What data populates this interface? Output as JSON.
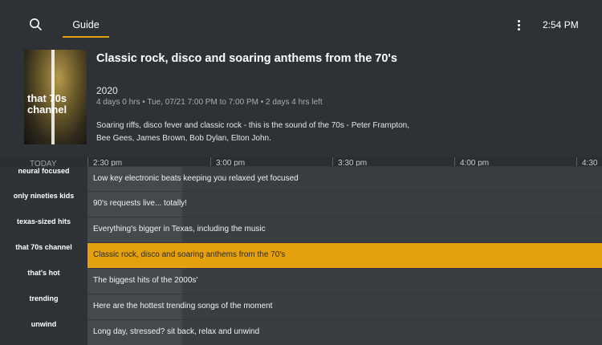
{
  "header": {
    "search_icon": "search-icon",
    "tab_guide": "Guide",
    "menu_icon": "more-vertical-icon",
    "clock": "2:54 PM",
    "accent": "#e5a00d"
  },
  "detail": {
    "poster_text": "that 70s channel",
    "title": "Classic rock, disco and soaring anthems from the 70's",
    "year": "2020",
    "meta": "4 days 0 hrs • Tue, 07/21 7:00 PM to 7:00 PM • 2 days 4 hrs left",
    "description": "Soaring riffs, disco fever and classic rock - this is the sound of the 70s - Peter Frampton, Bee Gees, James Brown, Bob Dylan, Elton John."
  },
  "timeline": {
    "today": "TODAY",
    "ticks": [
      "2:30 pm",
      "3:00 pm",
      "3:30 pm",
      "4:00 pm",
      "4:30"
    ]
  },
  "channels": [
    {
      "logo": "neural focused",
      "program": "Low key electronic beats keeping you relaxed yet focused"
    },
    {
      "logo": "only nineties kids",
      "program": "90's requests live... totally!"
    },
    {
      "logo": "texas-sized hits",
      "program": "Everything's bigger in Texas, including the music"
    },
    {
      "logo": "that 70s channel",
      "program": "Classic rock, disco and soaring anthems from the 70's"
    },
    {
      "logo": "that's hot",
      "program": "The biggest hits of the 2000s'"
    },
    {
      "logo": "trending",
      "program": "Here are the hottest trending songs of the moment"
    },
    {
      "logo": "unwind",
      "program": "Long day, stressed? sit back, relax and unwind"
    }
  ]
}
